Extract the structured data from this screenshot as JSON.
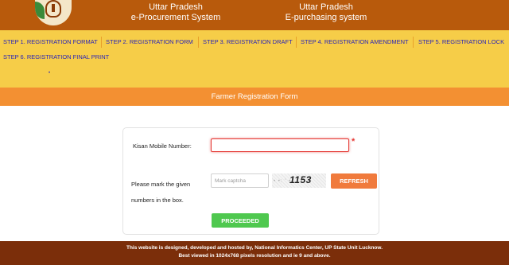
{
  "header": {
    "left_line1": "Uttar Pradesh",
    "left_line2": "e-Procurement System",
    "right_line1": "Uttar Pradesh",
    "right_line2": "E-purchasing system"
  },
  "menu": {
    "items": [
      "STEP 1. REGISTRATION FORMAT",
      "STEP 2. REGISTRATION FORM",
      "STEP 3. REGISTRATION DRAFT",
      "STEP 4. REGISTRATION AMENDMENT",
      "STEP 5. REGISTRATION LOCK",
      "STEP 6. REGISTRATION FINAL PRINT"
    ],
    "bullet": "•"
  },
  "form": {
    "title": "Farmer Registration Form",
    "mobile_label": "Kisan Mobile Number:",
    "mobile_value": "",
    "required_mark": "*",
    "captcha_label_line1": "Please mark the given",
    "captcha_label_line2": "numbers in the box.",
    "captcha_placeholder": "Mark captcha",
    "captcha_noise": "• •: ' •,",
    "captcha_value": "1153",
    "refresh_label": "REFRESH",
    "proceed_label": "PROCEEDED"
  },
  "footer": {
    "line1": "This website is designed, developed and hosted by, National Informatics Center, UP State Unit Lucknow.",
    "line2": "Best viewed in 1024x768 pixels resolution and ie 9 and above."
  },
  "colors": {
    "header_bg": "#b85a0c",
    "menu_bg": "#f6cd48",
    "menu_link": "#2a25b8",
    "title_bar": "#f39032",
    "refresh_btn": "#f07a3c",
    "proceed_btn": "#4fc84f",
    "footer_bg": "#7b2e0a"
  },
  "icons": {
    "logo": "up-government-emblem-icon"
  }
}
